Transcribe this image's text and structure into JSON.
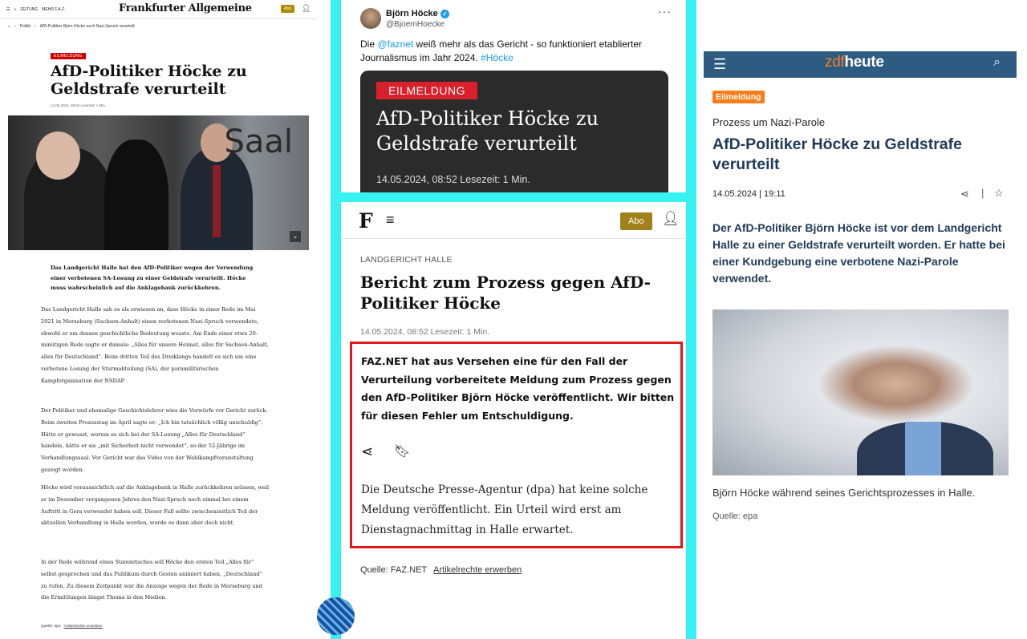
{
  "faz_desktop": {
    "topbar": {
      "zeitung_label": "ZEITUNG",
      "mehr_label": "MEHR F.A.Z.",
      "logo_text": "Frankfurter Allgemeine",
      "abo_label": "Abo"
    },
    "breadcrumb": [
      "Politik",
      "AfD-Politiker Björn Höcke nach Nazi-Spruch verurteilt"
    ],
    "badge": "EILMELDUNG",
    "headline": "AfD-Politiker Höcke zu Geldstrafe verurteilt",
    "meta": "14.05.2024, 08:52   Lesezeit: 1 Min.",
    "photo_text": "Saal",
    "lead": "Das Landgericht Halle hat den AfD-Politiker wegen der Verwendung einer verbotenen SA-Losung zu einer Geldstrafe verurteilt. Höcke muss wahrscheinlich auf die Anklagebank zurückkehren.",
    "paragraphs": [
      "Das Landgericht Halle sah es als erwiesen an, dass Höcke in einer Rede im Mai 2021 in Merseburg (Sachsen-Anhalt) einen verbotenen Nazi-Spruch verwendete, obwohl er um dessen geschichtliche Bedeutung wusste. Am Ende einer etwa 20-minütigen Rede sagte er damals: „Alles für unsere Heimat, alles für Sachsen-Anhalt, alles für Deutschland“. Beim dritten Teil des Dreiklangs handelt es sich um eine verbotene Losung der Sturmabteilung (SA), der paramilitärischen Kampforganisation der NSDAP.",
      "Der Politiker und ehemalige Geschichtslehrer wies die Vorwürfe vor Gericht zurück. Beim zweiten Prozesstag im April sagte er: „Ich bin tatsächlich völlig unschuldig“. Hätte er gewusst, worum es sich bei der SA-Losung „Alles für Deutschland“ handele, hätte er sie „mit Sicherheit nicht verwendet“, so der 52-Jährige im Verhandlungssaal. Vor Gericht war das Video von der Wahlkampfveranstaltung gezeigt worden.",
      "Höcke wird voraussichtlich auf die Anklagebank in Halle zurückkehren müssen, weil er im Dezember vergangenen Jahres den Nazi-Spruch noch einmal bei einem Auftritt in Gera verwendet haben soll. Dieser Fall sollte zwischenzeitlich Teil der aktuellen Verhandlung in Halle werden, wurde es dann aber doch nicht.",
      "In der Rede während eines Stammtisches soll Höcke den ersten Teil „Alles für“ selbst gesprochen und das Publikum durch Gesten animiert haben, „Deutschland“ zu rufen. Zu diesem Zeitpunkt war die Anzeige wegen der Rede in Merseburg und die Ermittlungen längst Thema in den Medien."
    ],
    "source": "Quelle: dpa",
    "rights_link": "Artikelrechte erwerben"
  },
  "tweet": {
    "author_name": "Björn Höcke",
    "author_handle": "@BjoernHoecke",
    "text_prefix": "Die ",
    "mention": "@faznet",
    "text_middle": " weiß mehr als das Gericht - so funktioniert etablierter Journalismus im Jahr 2024. ",
    "hashtag": "#Höcke",
    "card": {
      "badge": "EILMELDUNG",
      "headline": "AfD-Politiker Höcke zu Geldstrafe verurteilt",
      "meta": "14.05.2024, 08:52   Lesezeit: 1 Min."
    }
  },
  "faz_mobile": {
    "logo": "F",
    "abo_label": "Abo",
    "kicker": "LANDGERICHT HALLE",
    "title": "Bericht zum Prozess gegen AfD-Politiker Höcke",
    "meta": "14.05.2024, 08:52   Lesezeit: 1 Min.",
    "correction": "FAZ.NET hat aus Versehen eine für den Fall der Verurteilung vorbereitete Meldung zum Prozess gegen den AfD-Politiker Björn Höcke veröffentlicht. Wir bitten für diesen Fehler um Entschuldigung.",
    "body": "Die Deutsche Presse-Agentur (dpa) hat keine solche Meldung veröffentlicht. Ein Urteil wird erst am Dienstagnachmittag in Halle erwartet.",
    "source": "Quelle: FAZ.NET",
    "rights_link": "Artikelrechte erwerben"
  },
  "zdf": {
    "logo_zdf": "zdf",
    "logo_heute": "heute",
    "badge": "Eilmeldung",
    "kicker": "Prozess um Nazi-Parole",
    "title": "AfD-Politiker Höcke zu Geldstrafe verurteilt",
    "date": "14.05.2024 | 19:11",
    "lead": "Der AfD-Politiker Björn Höcke ist vor dem Landgericht Halle zu einer Geldstrafe verurteilt worden. Er hatte bei einer Kundgebung eine verbotene Nazi-Parole verwendet.",
    "caption": "Björn Höcke während seines Gerichtsprozesses in Halle.",
    "source": "Quelle: epa"
  },
  "colors": {
    "frame_cyan": "#38f2f2",
    "faz_red": "#cc0000",
    "highlight_box": "#e11818",
    "zdf_blue": "#2d5b82",
    "zdf_orange": "#fa7d19",
    "twitter_blue": "#1d9bf0"
  },
  "icons": [
    "menu-icon",
    "search-icon",
    "user-icon",
    "share-icon",
    "bookmark-icon",
    "star-icon",
    "verified-icon",
    "more-icon",
    "home-icon",
    "chevron-down-icon"
  ]
}
